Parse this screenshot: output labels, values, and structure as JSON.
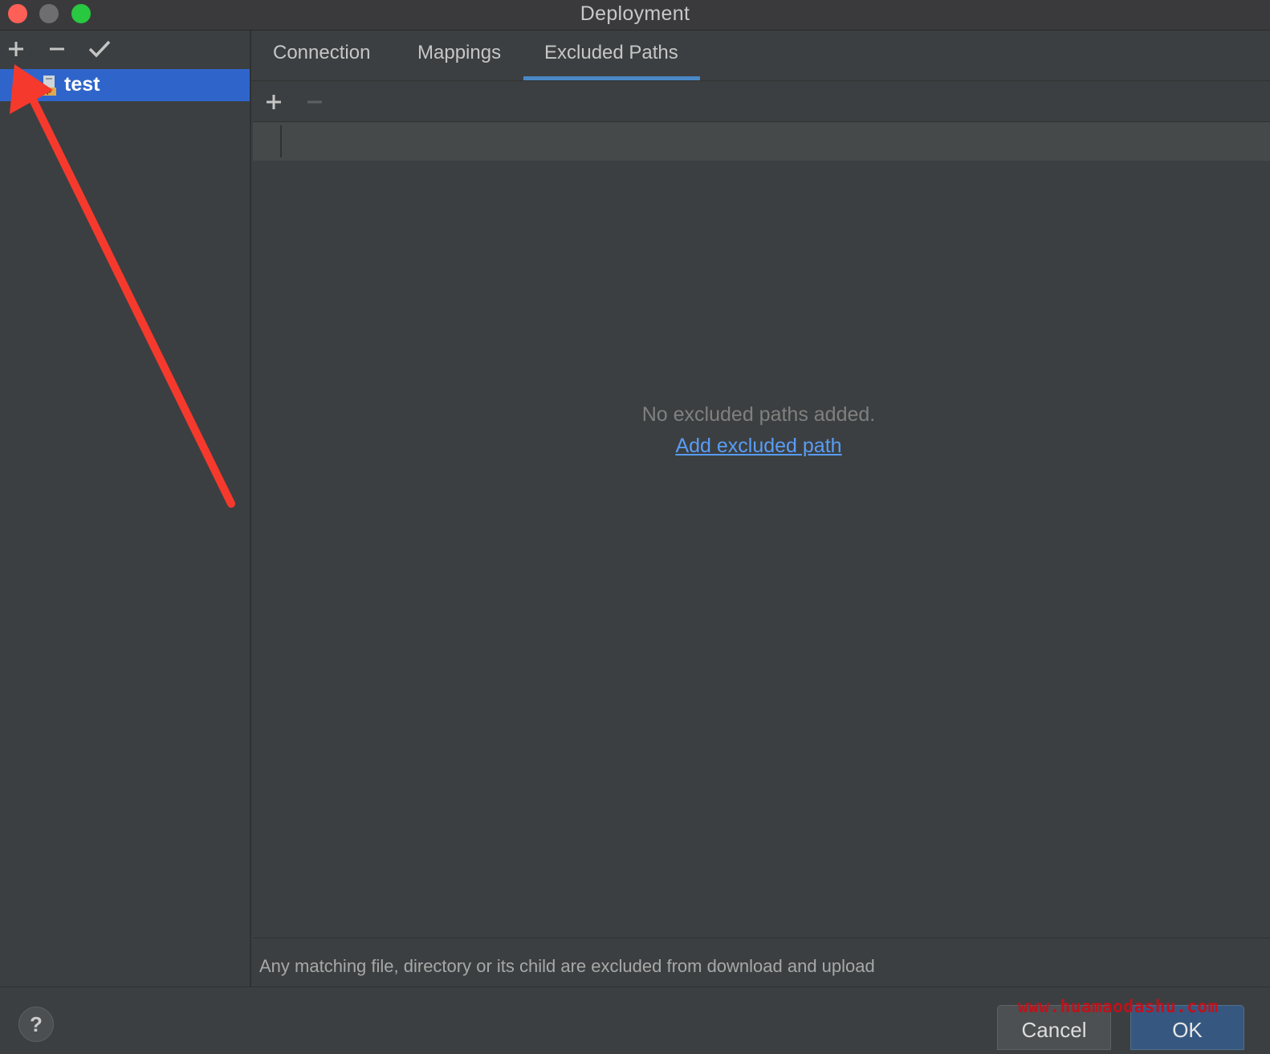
{
  "window": {
    "title": "Deployment",
    "traffic_lights": {
      "close_color": "#fe5f57",
      "minimize_color": "#6e6e70",
      "zoom_color": "#28c840"
    }
  },
  "sidebar": {
    "toolbar": [
      {
        "icon": "plus-icon"
      },
      {
        "icon": "minus-icon"
      },
      {
        "icon": "checkmark-icon"
      }
    ],
    "servers": [
      {
        "label": "test",
        "icon": "ftp-server-icon",
        "selected": true
      }
    ]
  },
  "tabs": [
    {
      "label": "Connection",
      "active": false
    },
    {
      "label": "Mappings",
      "active": false
    },
    {
      "label": "Excluded Paths",
      "active": true
    }
  ],
  "excluded_paths": {
    "toolbar": [
      {
        "icon": "plus-icon",
        "enabled": true
      },
      {
        "icon": "minus-icon",
        "enabled": false
      }
    ],
    "empty_message": "No excluded paths added.",
    "add_link": "Add excluded path",
    "hint": "Any matching file, directory or its child are excluded from download and upload"
  },
  "footer": {
    "help_label": "?",
    "cancel_label": "Cancel",
    "ok_label": "OK"
  },
  "watermark": "www.huamaodashu.com",
  "annotation": {
    "type": "red-arrow",
    "color": "#f6392d"
  },
  "colors": {
    "accent": "#4a88c7",
    "selection": "#2f65ca",
    "link": "#589df6",
    "ok_button": "#365880"
  }
}
